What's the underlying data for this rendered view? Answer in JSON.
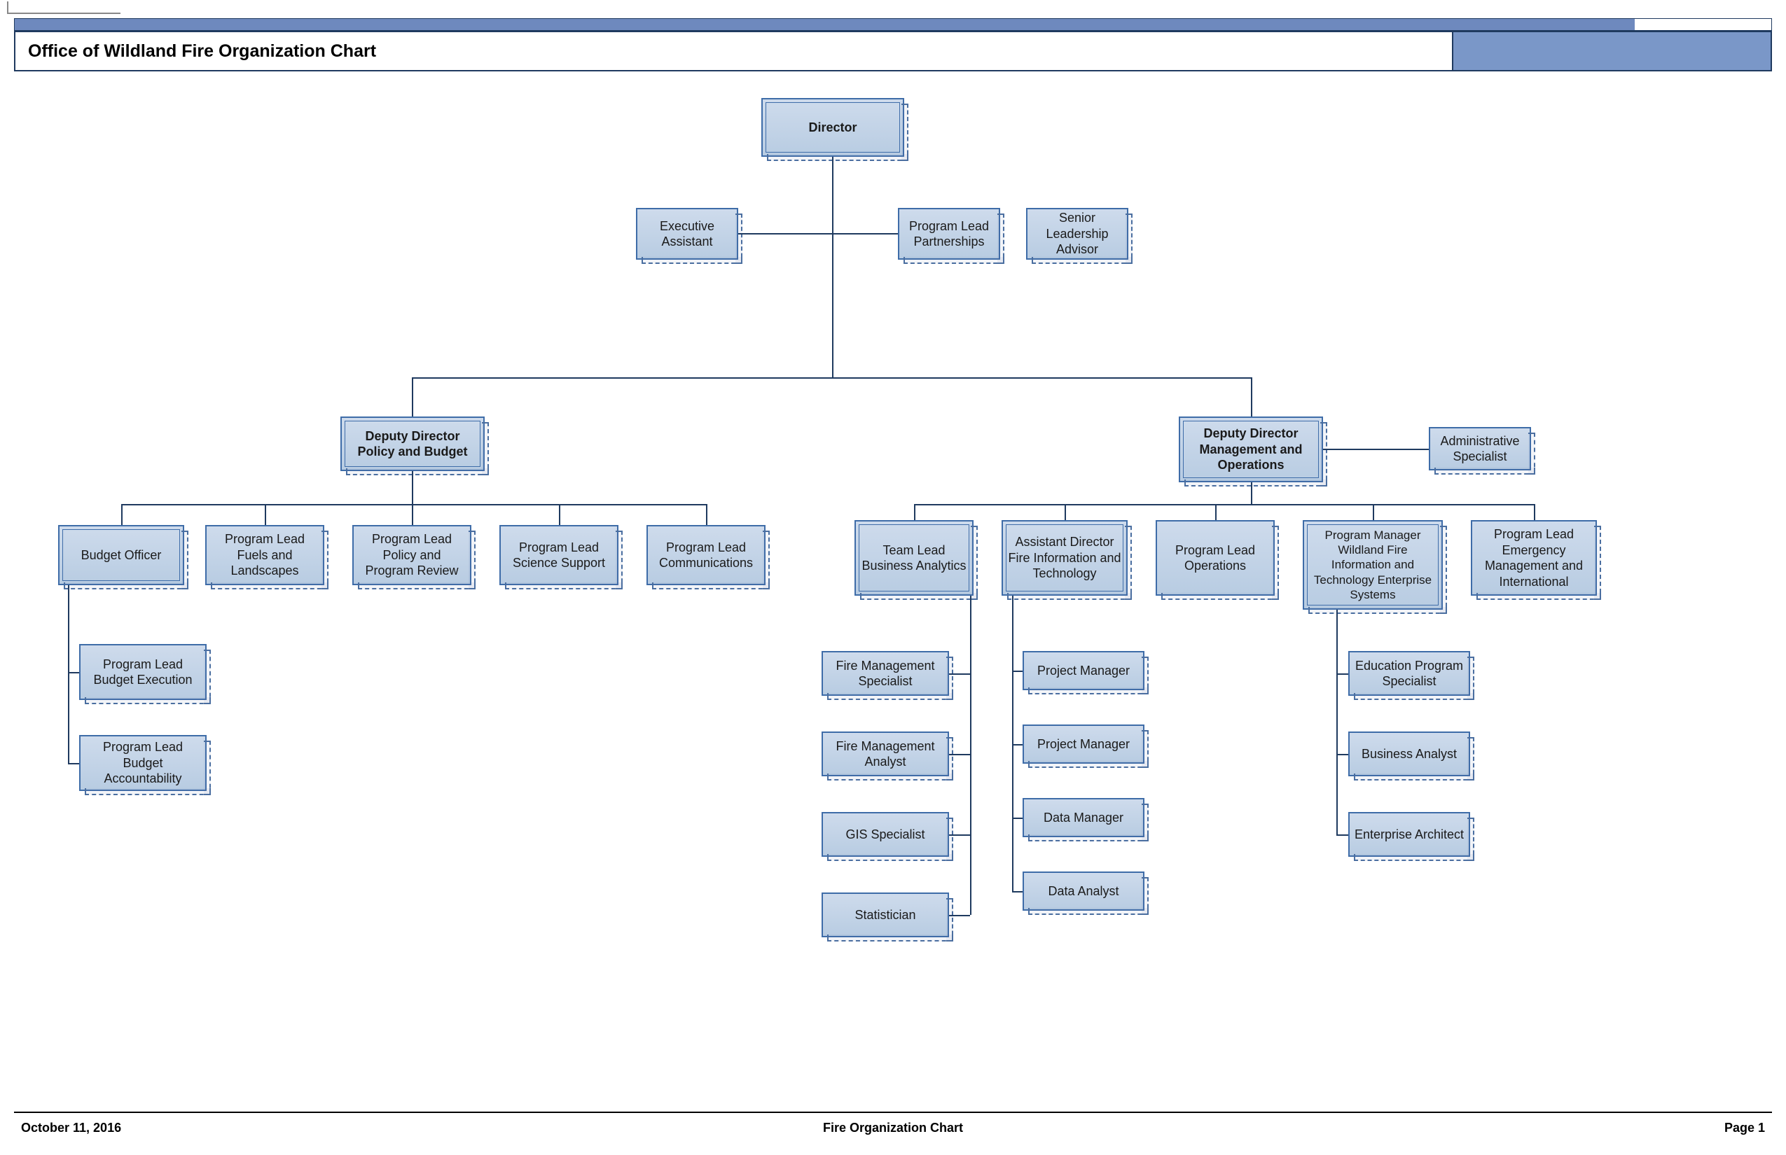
{
  "header": {
    "title": "Office of Wildland Fire Organization Chart"
  },
  "footer": {
    "date": "October 11, 2016",
    "title": "Fire Organization Chart",
    "page": "Page 1"
  },
  "nodes": {
    "director": "Director",
    "exec_asst": "Executive Assistant",
    "prog_lead_partnerships": "Program Lead Partnerships",
    "senior_advisor": "Senior Leadership Advisor",
    "deputy_policy": "Deputy Director Policy and Budget",
    "deputy_ops": "Deputy Director Management and Operations",
    "admin_spec": "Administrative Specialist",
    "budget_officer": "Budget Officer",
    "fuels": "Program Lead Fuels and Landscapes",
    "policy_review": "Program Lead Policy and Program Review",
    "science": "Program Lead Science Support",
    "comms": "Program Lead Communications",
    "budget_exec": "Program Lead Budget Execution",
    "budget_acct": "Program Lead Budget Accountability",
    "team_biz": "Team Lead Business Analytics",
    "asst_dir_fit": "Assistant Director Fire Information and Technology",
    "ops": "Program Lead Operations",
    "pm_wfitse": "Program Manager Wildland Fire Information and Technology Enterprise Systems",
    "emergency": "Program Lead Emergency Management and International",
    "fire_spec": "Fire Management Specialist",
    "fire_analyst": "Fire Management Analyst",
    "gis": "GIS Specialist",
    "statistician": "Statistician",
    "pm1": "Project Manager",
    "pm2": "Project Manager",
    "data_mgr": "Data Manager",
    "data_analyst": "Data Analyst",
    "edu_spec": "Education Program Specialist",
    "biz_analyst": "Business Analyst",
    "ent_arch": "Enterprise Architect"
  }
}
